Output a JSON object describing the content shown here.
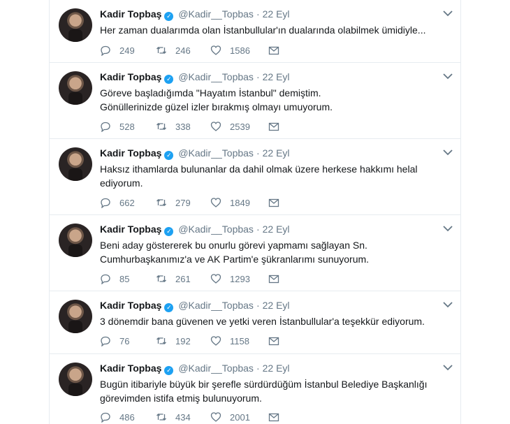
{
  "tweets": [
    {
      "name": "Kadir Topbaş",
      "handle": "@Kadir__Topbas",
      "time": "22 Eyl",
      "text": "Her zaman dualarımda olan İstanbullular'ın dualarında olabilmek ümidiyle...",
      "replies": "249",
      "retweets": "246",
      "likes": "1586"
    },
    {
      "name": "Kadir Topbaş",
      "handle": "@Kadir__Topbas",
      "time": "22 Eyl",
      "text": "Göreve başladığımda \"Hayatım İstanbul\" demiştim.\nGönüllerinizde güzel izler bırakmış olmayı umuyorum.",
      "replies": "528",
      "retweets": "338",
      "likes": "2539"
    },
    {
      "name": "Kadir Topbaş",
      "handle": "@Kadir__Topbas",
      "time": "22 Eyl",
      "text": "Haksız ithamlarda bulunanlar da dahil olmak üzere herkese hakkımı helal\nediyorum.",
      "replies": "662",
      "retweets": "279",
      "likes": "1849"
    },
    {
      "name": "Kadir Topbaş",
      "handle": "@Kadir__Topbas",
      "time": "22 Eyl",
      "text": "Beni aday göstererek bu onurlu görevi yapmamı sağlayan Sn.\nCumhurbaşkanımız'a ve AK Partim'e şükranlarımı sunuyorum.",
      "replies": "85",
      "retweets": "261",
      "likes": "1293"
    },
    {
      "name": "Kadir Topbaş",
      "handle": "@Kadir__Topbas",
      "time": "22 Eyl",
      "text": "3 dönemdir bana güvenen ve yetki veren İstanbullular'a teşekkür ediyorum.",
      "replies": "76",
      "retweets": "192",
      "likes": "1158"
    },
    {
      "name": "Kadir Topbaş",
      "handle": "@Kadir__Topbas",
      "time": "22 Eyl",
      "text": "Bugün itibariyle büyük bir şerefle sürdürdüğüm İstanbul Belediye Başkanlığı\ngörevimden istifa etmiş bulunuyorum.",
      "replies": "486",
      "retweets": "434",
      "likes": "2001"
    }
  ],
  "icons": {
    "reply": "reply-icon",
    "retweet": "retweet-icon",
    "like": "heart-icon",
    "dm": "envelope-icon",
    "caret": "chevron-down-icon",
    "verified": "verified-badge-icon"
  },
  "colors": {
    "verified": "#1da1f2",
    "secondary_text": "#657786",
    "divider": "#e6ecf0"
  }
}
